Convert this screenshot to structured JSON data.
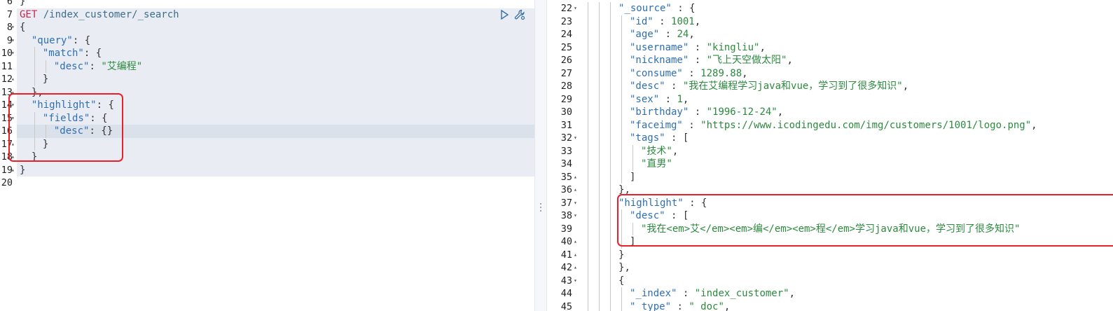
{
  "request": {
    "method": "GET",
    "path": " /index_customer/_search",
    "lines": [
      {
        "n": "6",
        "fold": "",
        "code": "}"
      },
      {
        "n": "7",
        "fold": "",
        "code": ""
      },
      {
        "n": "8",
        "fold": "▾",
        "code": "{"
      },
      {
        "n": "9",
        "fold": "▾",
        "code": "  \"query\": {"
      },
      {
        "n": "10",
        "fold": "▾",
        "code": "    \"match\": {"
      },
      {
        "n": "11",
        "fold": "",
        "code": "      \"desc\": \"艾编程\""
      },
      {
        "n": "12",
        "fold": "▴",
        "code": "    }"
      },
      {
        "n": "13",
        "fold": "▴",
        "code": "  },"
      },
      {
        "n": "14",
        "fold": "▾",
        "code": "  \"highlight\": {"
      },
      {
        "n": "15",
        "fold": "▾",
        "code": "    \"fields\": {"
      },
      {
        "n": "16",
        "fold": "",
        "code": "      \"desc\": {}"
      },
      {
        "n": "17",
        "fold": "▴",
        "code": "    }"
      },
      {
        "n": "18",
        "fold": "▴",
        "code": "  }"
      },
      {
        "n": "19",
        "fold": "▴",
        "code": "}"
      },
      {
        "n": "20",
        "fold": "",
        "code": ""
      }
    ]
  },
  "response": {
    "lines": [
      {
        "n": "22",
        "fold": "▾",
        "code": "\"_source\" : {"
      },
      {
        "n": "23",
        "fold": "",
        "code": "  \"id\" : 1001,"
      },
      {
        "n": "24",
        "fold": "",
        "code": "  \"age\" : 24,"
      },
      {
        "n": "25",
        "fold": "",
        "code": "  \"username\" : \"kingliu\","
      },
      {
        "n": "26",
        "fold": "",
        "code": "  \"nickname\" : \"飞上天空做太阳\","
      },
      {
        "n": "27",
        "fold": "",
        "code": "  \"consume\" : 1289.88,"
      },
      {
        "n": "28",
        "fold": "",
        "code": "  \"desc\" : \"我在艾编程学习java和vue，学习到了很多知识\","
      },
      {
        "n": "29",
        "fold": "",
        "code": "  \"sex\" : 1,"
      },
      {
        "n": "30",
        "fold": "",
        "code": "  \"birthday\" : \"1996-12-24\","
      },
      {
        "n": "31",
        "fold": "",
        "code": "  \"faceimg\" : \"https://www.icodingedu.com/img/customers/1001/logo.png\","
      },
      {
        "n": "32",
        "fold": "▾",
        "code": "  \"tags\" : ["
      },
      {
        "n": "33",
        "fold": "",
        "code": "    \"技术\","
      },
      {
        "n": "34",
        "fold": "",
        "code": "    \"直男\""
      },
      {
        "n": "35",
        "fold": "▴",
        "code": "  ]"
      },
      {
        "n": "36",
        "fold": "▴",
        "code": "},"
      },
      {
        "n": "37",
        "fold": "▾",
        "code": "\"highlight\" : {"
      },
      {
        "n": "38",
        "fold": "▾",
        "code": "  \"desc\" : ["
      },
      {
        "n": "39",
        "fold": "",
        "code": "    \"我在<em>艾</em><em>编</em><em>程</em>学习java和vue，学习到了很多知识\""
      },
      {
        "n": "40",
        "fold": "▴",
        "code": "  ]"
      },
      {
        "n": "41",
        "fold": "▴",
        "code": "}"
      },
      {
        "n": "42",
        "fold": "▴",
        "code": "},"
      },
      {
        "n": "43",
        "fold": "▾",
        "code": "{"
      },
      {
        "n": "44",
        "fold": "",
        "code": "  \"_index\" : \"index_customer\","
      },
      {
        "n": "45",
        "fold": "",
        "code": "  \"_type\" : \"_doc\","
      }
    ]
  },
  "colors": {
    "highlight_box": "#e8202a",
    "method": "#c7254e",
    "string": "#2b8a3e",
    "key": "#2e6fb3"
  },
  "icons": {
    "run": "play-icon",
    "settings": "wrench-icon"
  }
}
